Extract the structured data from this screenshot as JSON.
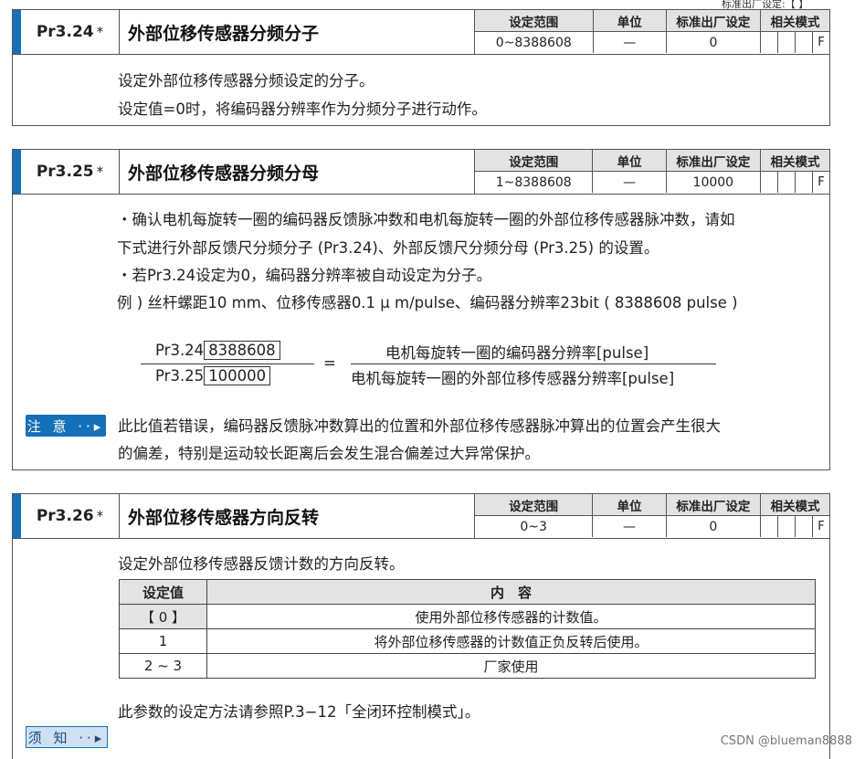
{
  "top_note": "标准出厂设定:【 】",
  "meta_headers": {
    "range": "设定范围",
    "unit": "单位",
    "default": "标准出厂设定",
    "mode": "相关模式"
  },
  "mode_letter": "F",
  "params": [
    {
      "code": "Pr3.24",
      "star": "*",
      "title": "外部位移传感器分频分子",
      "range": "0~8388608",
      "unit": "—",
      "default": "0",
      "lines": [
        "设定外部位移传感器分频设定的分子。",
        "设定值=0时，将编码器分辨率作为分频分子进行动作。"
      ]
    },
    {
      "code": "Pr3.25",
      "star": "*",
      "title": "外部位移传感器分频分母",
      "range": "1~8388608",
      "unit": "—",
      "default": "10000",
      "lines": [
        "・确认电机每旋转一圈的编码器反馈脉冲数和电机每旋转一圈的外部位移传感器脉冲数，请如",
        "  下式进行外部反馈尺分频分子 (Pr3.24)、外部反馈尺分频分母 (Pr3.25) 的设置。",
        "・若Pr3.24设定为0，编码器分辨率被自动设定为分子。",
        "例 ) 丝杆螺距10 mm、位移传感器0.1 μ m/pulse、编码器分辨率23bit ( 8388608 pulse )"
      ],
      "formula": {
        "num_label": "Pr3.24",
        "num_value": "8388608",
        "den_label": "Pr3.25",
        "den_value": "100000",
        "equals": "=",
        "rhs_num": "电机每旋转一圈的编码器分辨率[pulse]",
        "rhs_den": "电机每旋转一圈的外部位移传感器分辨率[pulse]"
      },
      "note_tag": "注 意 ··▸",
      "note_lines": [
        "此比值若错误，编码器反馈脉冲数算出的位置和外部位移传感器脉冲算出的位置会产生很大",
        "的偏差，特别是运动较长距离后会发生混合偏差过大异常保护。"
      ]
    },
    {
      "code": "Pr3.26",
      "star": "*",
      "title": "外部位移传感器方向反转",
      "range": "0~3",
      "unit": "—",
      "default": "0",
      "lines": [
        "设定外部位移传感器反馈计数的方向反转。"
      ],
      "table": {
        "headers": [
          "设定值",
          "内　容"
        ],
        "rows": [
          [
            "【 0 】",
            "使用外部位移传感器的计数值。"
          ],
          [
            "1",
            "将外部位移传感器的计数值正负反转后使用。"
          ],
          [
            "2 ~ 3",
            "厂家使用"
          ]
        ]
      },
      "ref_line": "此参数的设定方法请参照P.3−12「全闭环控制模式」。",
      "note_tag": "须 知 ··▸"
    }
  ],
  "watermark": "CSDN @blueman8888"
}
